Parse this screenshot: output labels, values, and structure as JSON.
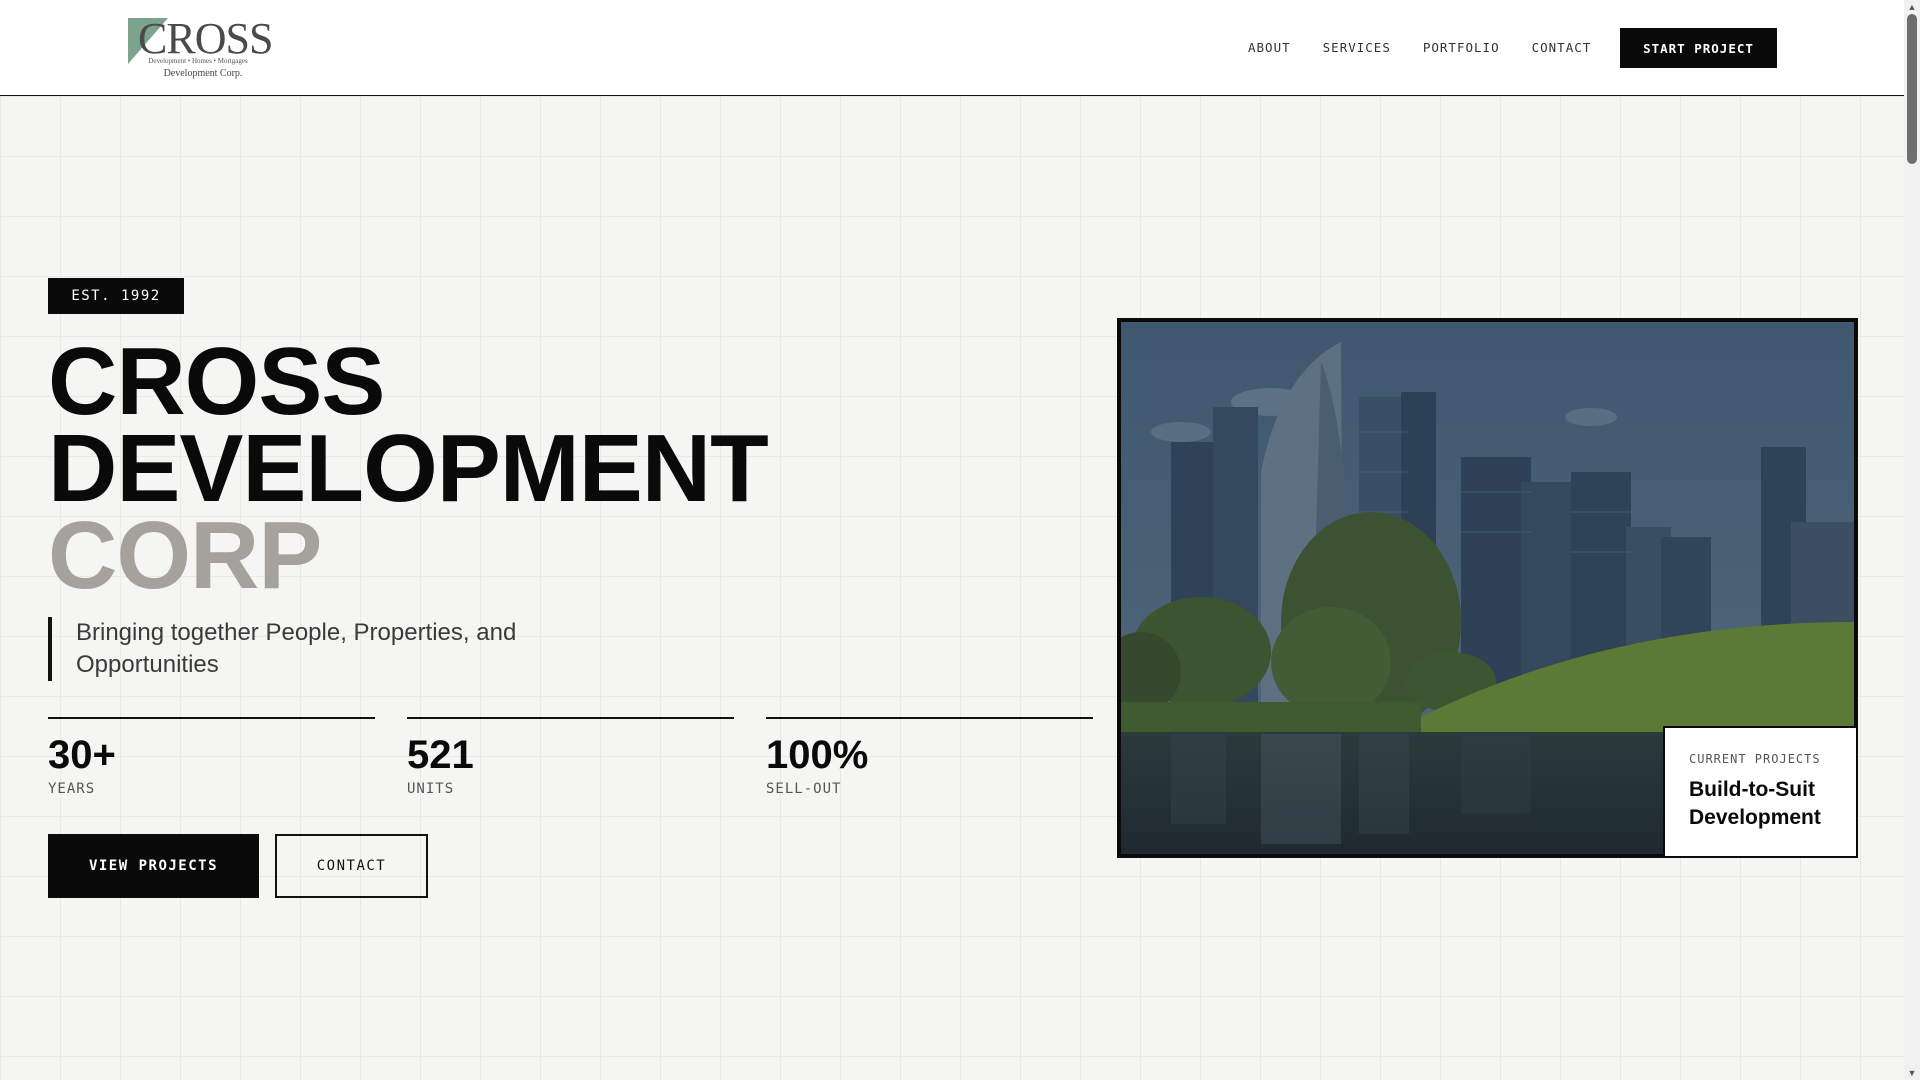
{
  "header": {
    "logo": {
      "word": "CROSS",
      "tagline": "Development • Homes • Mortgages",
      "sub": "Development Corp.",
      "mark_color": "#7ba38d"
    },
    "nav": [
      {
        "label": "ABOUT"
      },
      {
        "label": "SERVICES"
      },
      {
        "label": "PORTFOLIO"
      },
      {
        "label": "CONTACT"
      }
    ],
    "cta_label": "START PROJECT"
  },
  "hero": {
    "badge": "EST. 1992",
    "title_line1": "CROSS",
    "title_line2": "DEVELOPMENT",
    "title_line3": "CORP",
    "tagline": "Bringing together People, Properties, and Opportunities",
    "stats": [
      {
        "value": "30+",
        "label": "YEARS"
      },
      {
        "value": "521",
        "label": "UNITS"
      },
      {
        "value": "100%",
        "label": "SELL-OUT"
      }
    ],
    "primary_button": "VIEW PROJECTS",
    "secondary_button": "CONTACT"
  },
  "feature": {
    "image_subject": "city-skyline-park-pond",
    "card_kicker": "CURRENT PROJECTS",
    "card_title": "Build-to-Suit Development"
  },
  "colors": {
    "accent_dark": "#0a0a0a",
    "title_muted": "#a5a19c",
    "background": "#f5f5f3"
  }
}
